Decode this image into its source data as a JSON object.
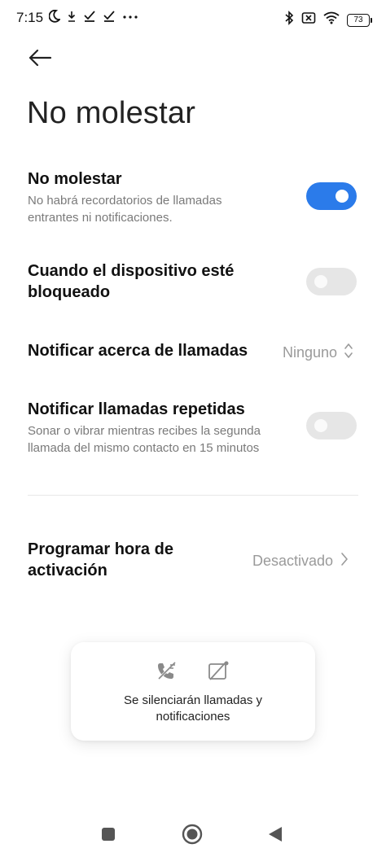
{
  "status_bar": {
    "time": "7:15",
    "left_icons": [
      "moon-icon",
      "download-icon",
      "check-icon",
      "check-icon",
      "more-dots-icon"
    ],
    "right_icons": [
      "bluetooth-icon",
      "sim-off-icon",
      "wifi-icon"
    ],
    "battery": "73"
  },
  "header": {
    "back_icon": "arrow-left-icon",
    "title": "No molestar"
  },
  "settings": {
    "dnd": {
      "title": "No molestar",
      "subtitle": "No habrá recordatorios de llamadas entrantes ni notificaciones.",
      "enabled": true
    },
    "locked": {
      "title": "Cuando el dispositivo esté bloqueado",
      "enabled": false
    },
    "notify_calls": {
      "title": "Notificar acerca de llamadas",
      "value": "Ninguno"
    },
    "repeat_calls": {
      "title": "Notificar llamadas repetidas",
      "subtitle": "Sonar o vibrar mientras recibes la segunda llamada del mismo contacto en 15 minutos",
      "enabled": false
    },
    "schedule": {
      "title": "Programar hora de activación",
      "value": "Desactivado"
    }
  },
  "info_card": {
    "icons": [
      "call-muted-icon",
      "notification-off-icon"
    ],
    "text": "Se silenciarán llamadas y notificaciones"
  },
  "nav_bar": {
    "buttons": [
      "recents-square-icon",
      "home-circle-icon",
      "back-triangle-icon"
    ]
  },
  "colors": {
    "accent": "#2b7bea",
    "toggle_off": "#e6e6e6",
    "secondary_text": "#7a7a7a"
  }
}
